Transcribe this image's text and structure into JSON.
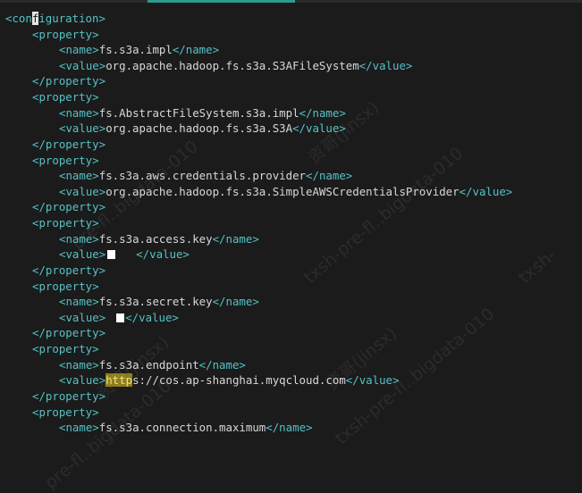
{
  "editor": {
    "lines": [
      {
        "open": "<con",
        "cursor": "f",
        "rest": "iguration>"
      },
      {
        "tag": "<property>"
      },
      {
        "t1": "<name>",
        "txt": "fs.s3a.impl",
        "t2": "</name>"
      },
      {
        "t1": "<value>",
        "txt": "org.apache.hadoop.fs.s3a.S3AFileSystem",
        "t2": "</value>"
      },
      {
        "tag": "</property>"
      },
      {
        "tag": "<property>"
      },
      {
        "t1": "<name>",
        "txt": "fs.AbstractFileSystem.s3a.impl",
        "t2": "</name>"
      },
      {
        "t1": "<value>",
        "txt": "org.apache.hadoop.fs.s3a.S3A",
        "t2": "</value>"
      },
      {
        "tag": "</property>"
      },
      {
        "tag": "<property>"
      },
      {
        "t1": "<name>",
        "txt": "fs.s3a.aws.credentials.provider",
        "t2": "</name>"
      },
      {
        "t1": "<value>",
        "txt": "org.apache.hadoop.fs.s3a.SimpleAWSCredentialsProvider",
        "t2": "</value>"
      },
      {
        "tag": "</property>"
      },
      {
        "tag": "<property>"
      },
      {
        "t1": "<name>",
        "txt": "fs.s3a.access.key",
        "t2": "</name>"
      },
      {
        "t1": "<value>",
        "t2": "</value>"
      },
      {
        "tag": "</property>"
      },
      {
        "tag": "<property>"
      },
      {
        "t1": "<name>",
        "txt": "fs.s3a.secret.key",
        "t2": "</name>"
      },
      {
        "t1": "<value>",
        "t2": "</value>"
      },
      {
        "tag": "</property>"
      },
      {
        "tag": "<property>"
      },
      {
        "t1": "<name>",
        "txt": "fs.s3a.endpoint",
        "t2": "</name>"
      },
      {
        "t1": "<value>",
        "hl": "http",
        "txt": "s://cos.ap-shanghai.myqcloud.com",
        "t2": "</value>"
      },
      {
        "tag": "</property>"
      },
      {
        "tag": "<property>"
      },
      {
        "t1": "<name>",
        "txt": "fs.s3a.connection.maximum",
        "t2": "</name>"
      }
    ]
  },
  "watermarks": {
    "w1": "pre-fl..bigdata-010",
    "w2": "资哥(jinsx)",
    "w3": "txsh-pre-fl..bigdata-010",
    "w4": "资哥(jinsx)",
    "w5": "pre-fl..bigdata-010",
    "w6": "txsh-pre-fl..bigdata-010",
    "w7": "资哥(jinsx)",
    "w8": "txsh-"
  },
  "colors": {
    "background": "#1b1b1b",
    "tag": "#55c1c6",
    "text": "#d8d8d8",
    "search_highlight": "#8c7b19",
    "active_tab": "#2f9a8c"
  }
}
